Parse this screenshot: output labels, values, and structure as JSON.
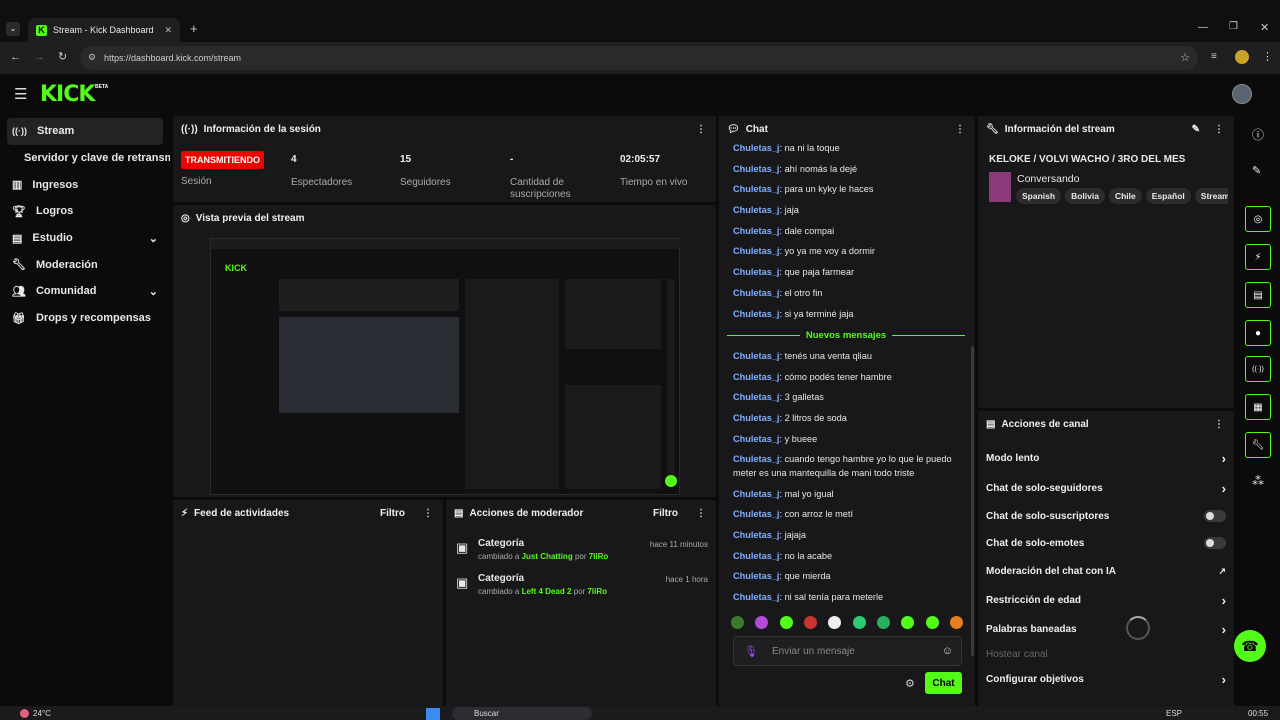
{
  "browser": {
    "tab_title": "Stream - Kick Dashboard",
    "new_tab": "+",
    "url": "https://dashboard.kick.com/stream"
  },
  "app": {
    "logo": "KICK",
    "logo_badge": "BETA"
  },
  "sidebar": {
    "items": [
      {
        "label": "Stream",
        "icon": "broadcast-icon"
      },
      {
        "label": "Servidor y clave de retransm",
        "icon": ""
      },
      {
        "label": "Ingresos",
        "icon": "chart-icon"
      },
      {
        "label": "Logros",
        "icon": "trophy-icon"
      },
      {
        "label": "Estudio",
        "icon": "studio-icon"
      },
      {
        "label": "Moderación",
        "icon": "wrench-icon"
      },
      {
        "label": "Comunidad",
        "icon": "people-icon"
      },
      {
        "label": "Drops y recompensas",
        "icon": "gift-icon"
      }
    ]
  },
  "session": {
    "title": "Información de la sesión",
    "status": "TRANSMITIENDO",
    "status_label": "Sesión",
    "viewers_value": "4",
    "viewers_label": "Espectadores",
    "followers_value": "15",
    "followers_label": "Seguidores",
    "subs_value": "-",
    "subs_label": "Cantidad de suscripciones",
    "time_value": "02:05:57",
    "time_label": "Tiempo en vivo"
  },
  "preview": {
    "title": "Vista previa del stream"
  },
  "activity": {
    "title": "Feed de actividades",
    "filter": "Filtro"
  },
  "modactions": {
    "title": "Acciones de moderador",
    "filter": "Filtro",
    "items": [
      {
        "title": "Categoría",
        "prefix": "cambiado a",
        "value": "Just Chatting",
        "by": "por",
        "user": "7liRo",
        "time": "hace 11 minutos"
      },
      {
        "title": "Categoría",
        "prefix": "cambiado a",
        "value": "Left 4 Dead 2",
        "by": "por",
        "user": "7liRo",
        "time": "hace 1 hora"
      }
    ]
  },
  "chat": {
    "title": "Chat",
    "messages_before": [
      {
        "user": "Chuletas_j",
        "text": ": na ni la toque"
      },
      {
        "user": "Chuletas_j",
        "text": ": ahí nomás la dejé"
      },
      {
        "user": "Chuletas_j",
        "text": ": para un kyky le haces"
      },
      {
        "user": "Chuletas_j",
        "text": ": jaja"
      },
      {
        "user": "Chuletas_j",
        "text": ": dale compai"
      },
      {
        "user": "Chuletas_j",
        "text": ": yo ya me voy a dormir"
      },
      {
        "user": "Chuletas_j",
        "text": ": que paja farmear"
      },
      {
        "user": "Chuletas_j",
        "text": ": el otro fin"
      },
      {
        "user": "Chuletas_j",
        "text": ": si ya terminé jaja"
      }
    ],
    "new_messages": "Nuevos mensajes",
    "messages_after": [
      {
        "user": "Chuletas_j",
        "text": ": tenés una venta qliau"
      },
      {
        "user": "Chuletas_j",
        "text": ": cómo podés tener hambre"
      },
      {
        "user": "Chuletas_j",
        "text": ": 3 galletas"
      },
      {
        "user": "Chuletas_j",
        "text": ": 2 litros de soda"
      },
      {
        "user": "Chuletas_j",
        "text": ": y bueee"
      },
      {
        "user": "Chuletas_j",
        "text": ": cuando tengo hambre yo lo que le puedo meter es una mantequilla de mani todo triste"
      },
      {
        "user": "Chuletas_j",
        "text": ": mal yo igual"
      },
      {
        "user": "Chuletas_j",
        "text": ": con arroz le metí"
      },
      {
        "user": "Chuletas_j",
        "text": ": jajaja"
      },
      {
        "user": "Chuletas_j",
        "text": ": no la acabe"
      },
      {
        "user": "Chuletas_j",
        "text": ": que mierda"
      },
      {
        "user": "Chuletas_j",
        "text": ": ni sal tenía para meterle"
      }
    ],
    "input_placeholder": "Enviar un mensaje",
    "send_label": "Chat"
  },
  "streaminfo": {
    "title": "Información del stream",
    "stream_title": "KELOKE / VOLVI WACHO / 3RO DEL MES",
    "category": "Conversando",
    "tags": [
      "Spanish",
      "Bolivia",
      "Chile",
      "Español",
      "Streame"
    ]
  },
  "channel_actions": {
    "title": "Acciones de canal",
    "items": [
      {
        "label": "Modo lento",
        "control": "chevron"
      },
      {
        "label": "Chat de solo-seguidores",
        "control": "chevron"
      },
      {
        "label": "Chat de solo-suscriptores",
        "control": "toggle"
      },
      {
        "label": "Chat de solo-emotes",
        "control": "toggle"
      },
      {
        "label": "Moderación del chat con IA",
        "control": "external"
      },
      {
        "label": "Restricción de edad",
        "control": "chevron"
      },
      {
        "label": "Palabras baneadas",
        "control": "chevron"
      },
      {
        "label": "Hostear canal",
        "control": "none"
      },
      {
        "label": "Configurar objetivos",
        "control": "chevron"
      }
    ]
  },
  "taskbar": {
    "weather": "24°C",
    "search": "Buscar",
    "lang": "ESP",
    "time": "00:55"
  },
  "colors": {
    "accent": "#53fc18",
    "live": "#eb0400",
    "chat_user": "#80aeff"
  }
}
